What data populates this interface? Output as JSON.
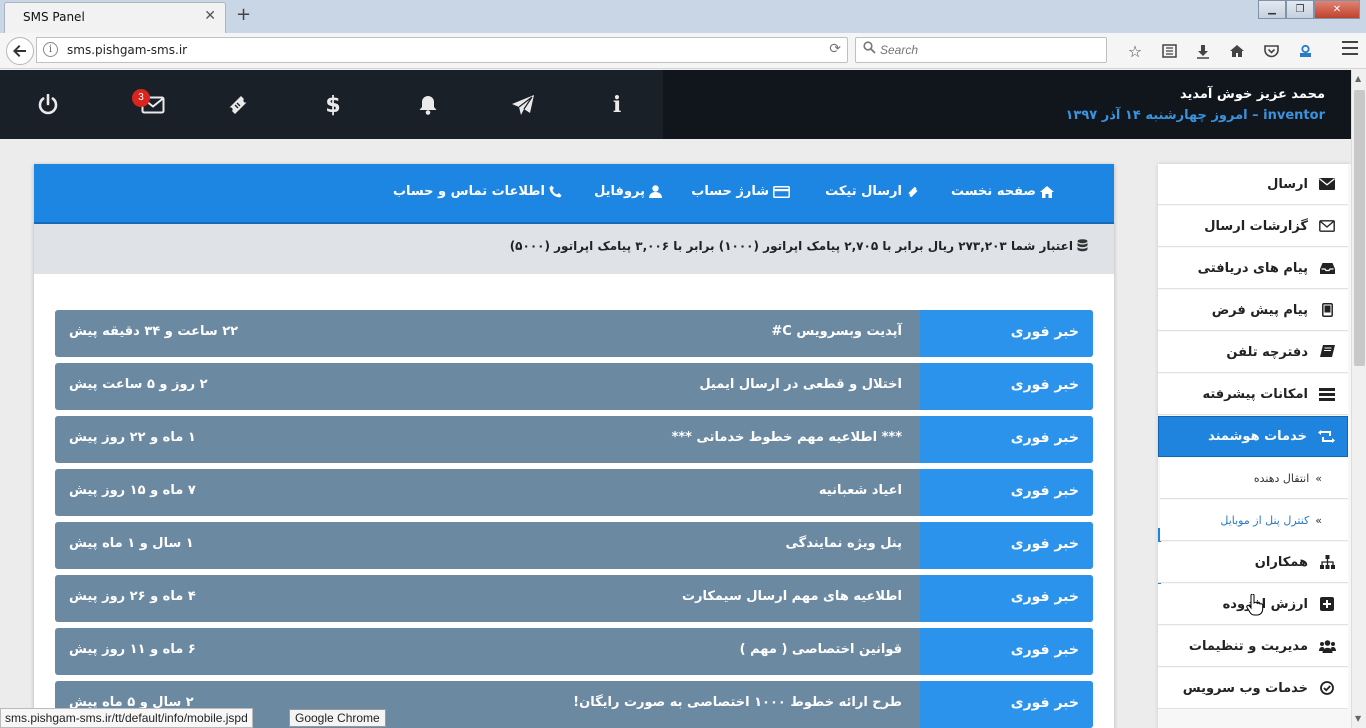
{
  "browser": {
    "tab_title": "SMS Panel",
    "tab_close": "✕",
    "new_tab": "+",
    "url": "sms.pishgam-sms.ir",
    "search_placeholder": "Search",
    "status_url": "sms.pishgam-sms.ir/tt/default/info/mobile.jspd",
    "taskbar_tooltip": "Google Chrome"
  },
  "header": {
    "welcome": "محمد عزیز خوش آمدید",
    "username": "inventor",
    "date_line": "– امروز چهارشنبه ۱۴ آذر ۱۳۹۷",
    "mail_badge": "3",
    "icons": [
      "power-icon",
      "envelope-icon",
      "ticket-icon",
      "dollar-icon",
      "bell-icon",
      "paper-plane-icon",
      "info-icon"
    ]
  },
  "top_nav": [
    {
      "label": "صفحه نخست",
      "icon": "home-icon"
    },
    {
      "label": "ارسال تیکت",
      "icon": "ticket-icon"
    },
    {
      "label": "شارژ حساب",
      "icon": "credit-card-icon"
    },
    {
      "label": "پروفایل",
      "icon": "user-icon"
    },
    {
      "label": "اطلاعات تماس و حساب",
      "icon": "phone-icon"
    }
  ],
  "credit": {
    "text": "اعتبار شما ۲۷۳,۲۰۳ ریال برابر با ۲,۷۰۵ پیامک اپراتور (۱۰۰۰) برابر با ۳,۰۰۶ پیامک اپراتور (۵۰۰۰)"
  },
  "news": [
    {
      "tag": "خبر فوری",
      "title": "آپدیت وبسرویس C#",
      "time": "۲۲ ساعت و ۳۴ دقیقه پیش"
    },
    {
      "tag": "خبر فوری",
      "title": "اختلال و قطعی در ارسال ایمیل",
      "time": "۲ روز و ۵ ساعت پیش"
    },
    {
      "tag": "خبر فوری",
      "title": "*** اطلاعیه مهم خطوط خدماتی ***",
      "time": "۱ ماه و ۲۲ روز پیش"
    },
    {
      "tag": "خبر فوری",
      "title": "اعیاد شعبانیه",
      "time": "۷ ماه و ۱۵ روز پیش"
    },
    {
      "tag": "خبر فوری",
      "title": "پنل ویژه نمایندگی",
      "time": "۱ سال و ۱ ماه پیش"
    },
    {
      "tag": "خبر فوری",
      "title": "اطلاعیه های مهم ارسال سیمکارت",
      "time": "۴ ماه و ۲۶ روز پیش"
    },
    {
      "tag": "خبر فوری",
      "title": "قوانین اختصاصی ( مهم )",
      "time": "۶ ماه و ۱۱ روز پیش"
    },
    {
      "tag": "خبر فوری",
      "title": "طرح ارائه خطوط ۱۰۰۰ اختصاصی به صورت رایگان!",
      "time": "۲ سال و ۵ ماه پیش"
    }
  ],
  "sidebar": {
    "items": [
      {
        "label": "ارسال",
        "icon": "envelope-filled-icon"
      },
      {
        "label": "گزارشات ارسال",
        "icon": "envelope-outline-icon"
      },
      {
        "label": "پیام های دریافتی",
        "icon": "inbox-icon"
      },
      {
        "label": "پیام پیش فرض",
        "icon": "tablet-icon"
      },
      {
        "label": "دفترچه تلفن",
        "icon": "book-icon"
      },
      {
        "label": "امکانات پیشرفته",
        "icon": "server-icon"
      },
      {
        "label": "خدمات هوشمند",
        "icon": "retweet-icon"
      },
      {
        "label": "همکاران",
        "icon": "sitemap-icon"
      },
      {
        "label": "ارزش افزوده",
        "icon": "plus-square-icon"
      },
      {
        "label": "مدیریت و تنظیمات",
        "icon": "users-icon"
      },
      {
        "label": "خدمات وب سرویس",
        "icon": "check-circle-icon"
      }
    ],
    "subitems": [
      {
        "label": "انتقال دهنده",
        "chevron": "»"
      },
      {
        "label": "کنترل پنل از موبایل",
        "chevron": "»"
      }
    ]
  },
  "colors": {
    "header_bg": "#1a2028",
    "nav_blue": "#1d86e2",
    "news_row": "#6c89a2",
    "news_tag": "#2b93ec",
    "badge_red": "#d9251e"
  }
}
